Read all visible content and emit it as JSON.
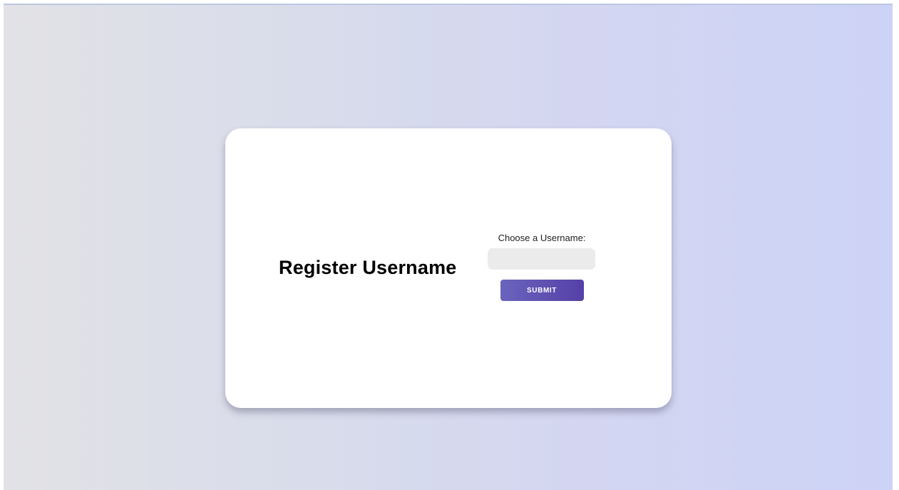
{
  "card": {
    "title": "Register Username"
  },
  "form": {
    "label": "Choose a Username:",
    "username_value": "",
    "username_placeholder": "",
    "submit_label": "SUBMIT"
  },
  "colors": {
    "button_start": "#6a64bd",
    "button_end": "#5640a8",
    "input_background": "#ebebeb",
    "card_background": "#ffffff"
  }
}
